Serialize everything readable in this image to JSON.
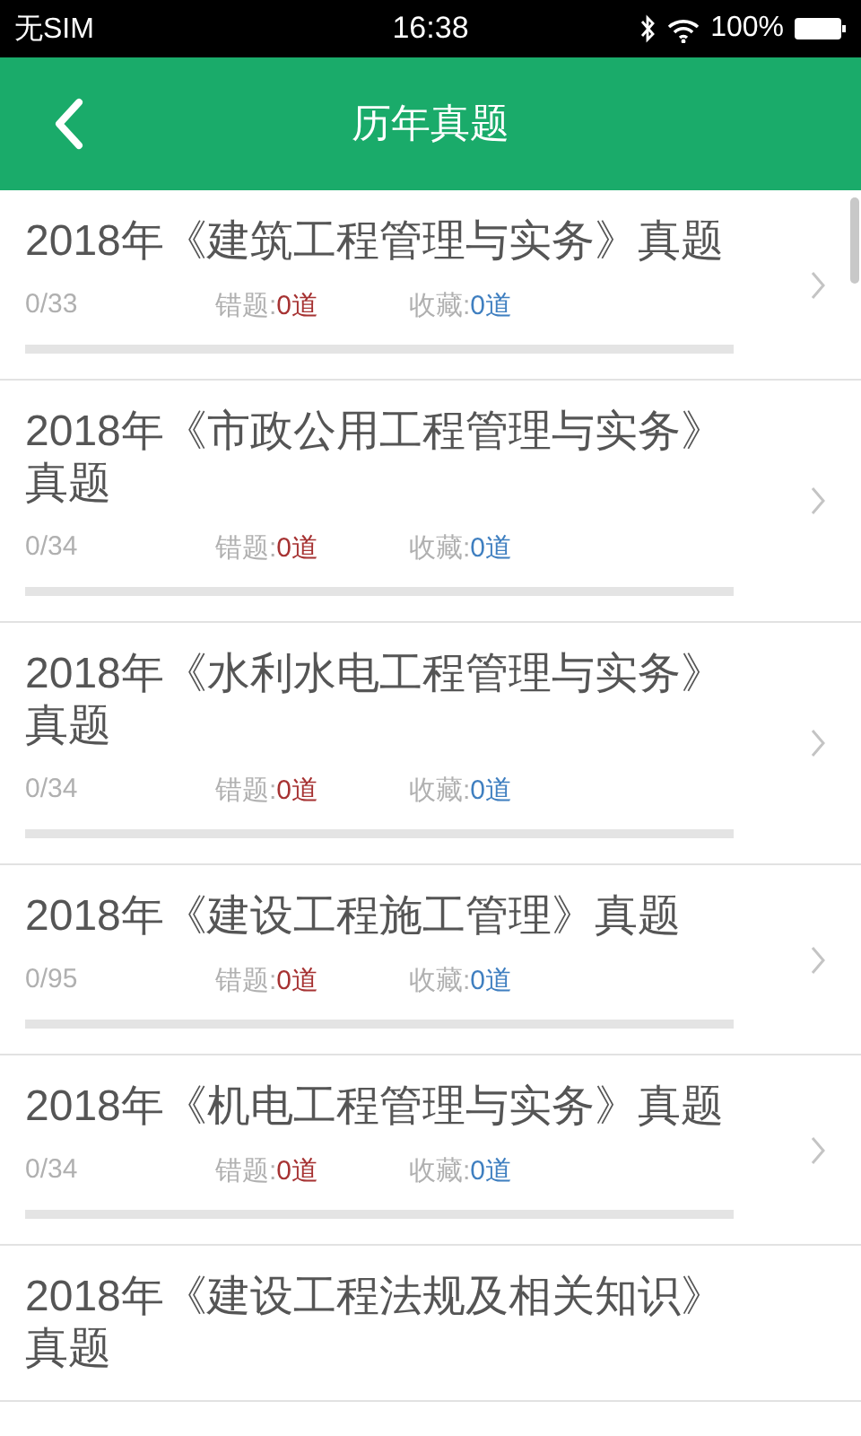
{
  "status_bar": {
    "carrier": "无SIM",
    "time": "16:38",
    "battery": "100%"
  },
  "header": {
    "title": "历年真题"
  },
  "items": [
    {
      "title": "2018年《建筑工程管理与实务》真题",
      "count": "0/33",
      "wrong_label": "错题:",
      "wrong_value": "0道",
      "fav_label": "收藏:",
      "fav_value": "0道",
      "level": 0
    },
    {
      "title": "2018年《市政公用工程管理与实务》真题",
      "count": "0/34",
      "wrong_label": "错题:",
      "wrong_value": "0道",
      "fav_label": "收藏:",
      "fav_value": "0道",
      "level": 0
    },
    {
      "title": "2018年《水利水电工程管理与实务》真题",
      "count": "0/34",
      "wrong_label": "错题:",
      "wrong_value": "0道",
      "fav_label": "收藏:",
      "fav_value": "0道",
      "level": 0
    },
    {
      "title": "2018年《建设工程施工管理》真题",
      "count": "0/95",
      "wrong_label": "错题:",
      "wrong_value": "0道",
      "fav_label": "收藏:",
      "fav_value": "0道",
      "level": 0
    },
    {
      "title": "2018年《机电工程管理与实务》真题",
      "count": "0/34",
      "wrong_label": "错题:",
      "wrong_value": "0道",
      "fav_label": "收藏:",
      "fav_value": "0道",
      "level": 0
    },
    {
      "title": "2018年《建设工程法规及相关知识》真题"
    }
  ]
}
